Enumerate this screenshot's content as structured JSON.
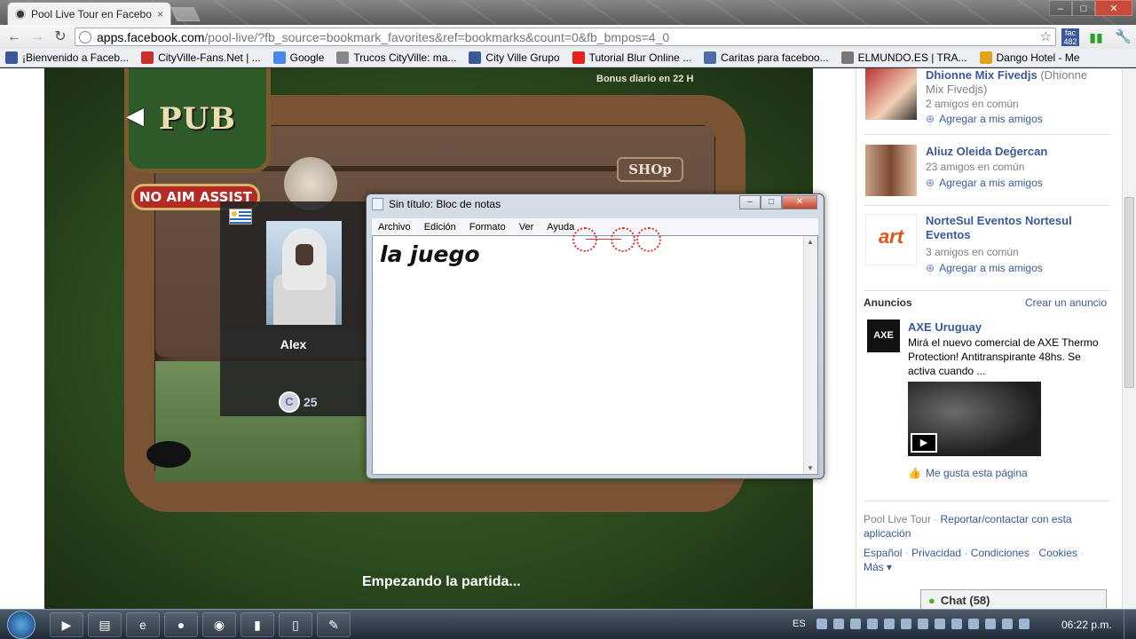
{
  "browser": {
    "tab_title": "Pool Live Tour en Facebook",
    "tab_close": "×",
    "url_host": "apps.facebook.com",
    "url_path": "/pool-live/?fb_source=bookmark_favorites&ref=bookmarks&count=0&fb_bmpos=4_0",
    "ext_badge": "482",
    "ext_label": "fac",
    "window_buttons": {
      "minimize": "–",
      "maximize": "□",
      "close": "✕"
    }
  },
  "bookmarks": [
    {
      "label": "¡Bienvenido a Faceb...",
      "color": "#3b5998"
    },
    {
      "label": "CityVille-Fans.Net | ...",
      "color": "#c9302c"
    },
    {
      "label": "Google",
      "color": "#4a86e8"
    },
    {
      "label": "Trucos CityVille: ma...",
      "color": "#888888"
    },
    {
      "label": "City Ville Grupo",
      "color": "#3b5998"
    },
    {
      "label": "Tutorial Blur Online ...",
      "color": "#e62117"
    },
    {
      "label": "Caritas para faceboo...",
      "color": "#4a6ea9"
    },
    {
      "label": "ELMUNDO.ES | TRA...",
      "color": "#777777"
    },
    {
      "label": "Dango Hotel - Me",
      "color": "#e3a21a"
    }
  ],
  "game": {
    "pub_sign": "PUB",
    "no_aim_assist": "NO AIM ASSIST",
    "bonus": "Bonus diario en 22 H",
    "shop": "SHOp",
    "player_name": "Alex",
    "coin_symbol": "C",
    "coin_value": "25",
    "status": "Empezando la partida..."
  },
  "notepad": {
    "title": "Sin título: Bloc de notas",
    "menu": [
      "Archivo",
      "Edición",
      "Formato",
      "Ver",
      "Ayuda"
    ],
    "content": "la juego"
  },
  "sidebar": {
    "friends": [
      {
        "name": "Dhionne Mix Fivedjs",
        "alt": "(Dhionne Mix Fivedjs)",
        "mutual": "2 amigos en común",
        "add": "Agregar a mis amigos"
      },
      {
        "name": "Aliuz Oleida Değercan",
        "alt": "",
        "mutual": "23 amigos en común",
        "add": "Agregar a mis amigos"
      },
      {
        "name": "NorteSul Eventos Nortesul Eventos",
        "alt": "",
        "mutual": "3 amigos en común",
        "add": "Agregar a mis amigos"
      }
    ],
    "ads_title": "Anuncios",
    "create_ad": "Crear un anuncio",
    "ad": {
      "logo": "AXE",
      "title": "AXE Uruguay",
      "body": "Mirá el nuevo comercial de AXE Thermo Protection! Antitranspirante 48hs. Se activa cuando ...",
      "like": "Me gusta esta página"
    },
    "footer": {
      "app": "Pool Live Tour",
      "report": "Reportar/contactar con esta aplicación",
      "links": [
        "Español",
        "Privacidad",
        "Condiciones",
        "Cookies"
      ],
      "more": "Más"
    },
    "chat": "Chat (58)"
  },
  "taskbar": {
    "lang": "ES",
    "clock": "06:22 p.m."
  }
}
